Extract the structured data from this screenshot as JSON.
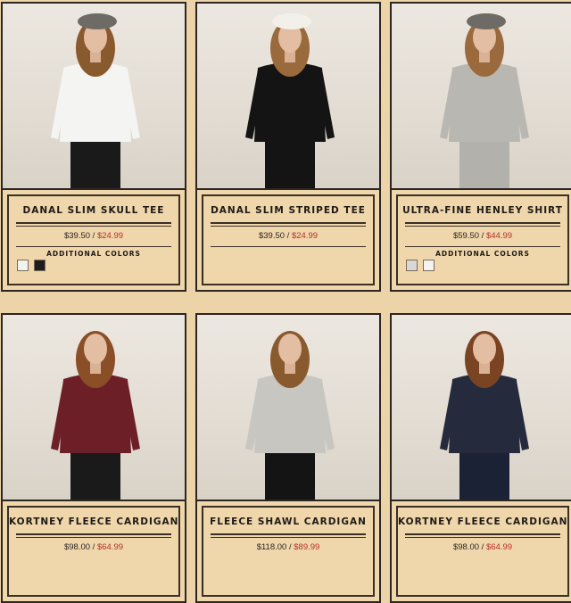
{
  "products": [
    {
      "name": "DANAL SLIM SKULL TEE",
      "price_original": "$39.50",
      "price_sale": "$24.99",
      "additional_colors_label": "ADDITIONAL COLORS",
      "swatches": [
        "#f2f2ef",
        "#1e1c1c"
      ],
      "palette": {
        "top": "#f4f4f2",
        "bottom": "#1b1a1a",
        "hat": "#6e6b66",
        "hair": "#8a5a2f"
      }
    },
    {
      "name": "DANAL SLIM STRIPED TEE",
      "price_original": "$39.50",
      "price_sale": "$24.99",
      "additional_colors_label": "",
      "swatches": [],
      "palette": {
        "top": "#151414",
        "bottom": "#151414",
        "hat": "#f3f0ea",
        "hair": "#9a6a3c"
      }
    },
    {
      "name": "ULTRA-FINE HENLEY SHIRT",
      "price_original": "$59.50",
      "price_sale": "$44.99",
      "additional_colors_label": "ADDITIONAL COLORS",
      "swatches": [
        "#d9d8d4",
        "#f4f3ef"
      ],
      "palette": {
        "top": "#b9b7b2",
        "bottom": "#b3b1ac",
        "hat": "#6e6b66",
        "hair": "#9a6a3c"
      }
    },
    {
      "name": "KORTNEY FLEECE CARDIGAN",
      "price_original": "$98.00",
      "price_sale": "$64.99",
      "additional_colors_label": "",
      "swatches": [],
      "palette": {
        "top": "#6d1f27",
        "bottom": "#1b1a1a",
        "hat": "",
        "hair": "#8a4f27"
      }
    },
    {
      "name": "FLEECE SHAWL CARDIGAN",
      "price_original": "$118.00",
      "price_sale": "$89.99",
      "additional_colors_label": "",
      "swatches": [],
      "palette": {
        "top": "#c7c6c1",
        "bottom": "#151414",
        "hat": "",
        "hair": "#8a5a2f"
      }
    },
    {
      "name": "KORTNEY FLEECE CARDIGAN",
      "price_original": "$98.00",
      "price_sale": "$64.99",
      "additional_colors_label": "",
      "swatches": [],
      "palette": {
        "top": "#252a3d",
        "bottom": "#1c2236",
        "hat": "",
        "hair": "#7a4423"
      }
    }
  ],
  "price_separator": "/"
}
